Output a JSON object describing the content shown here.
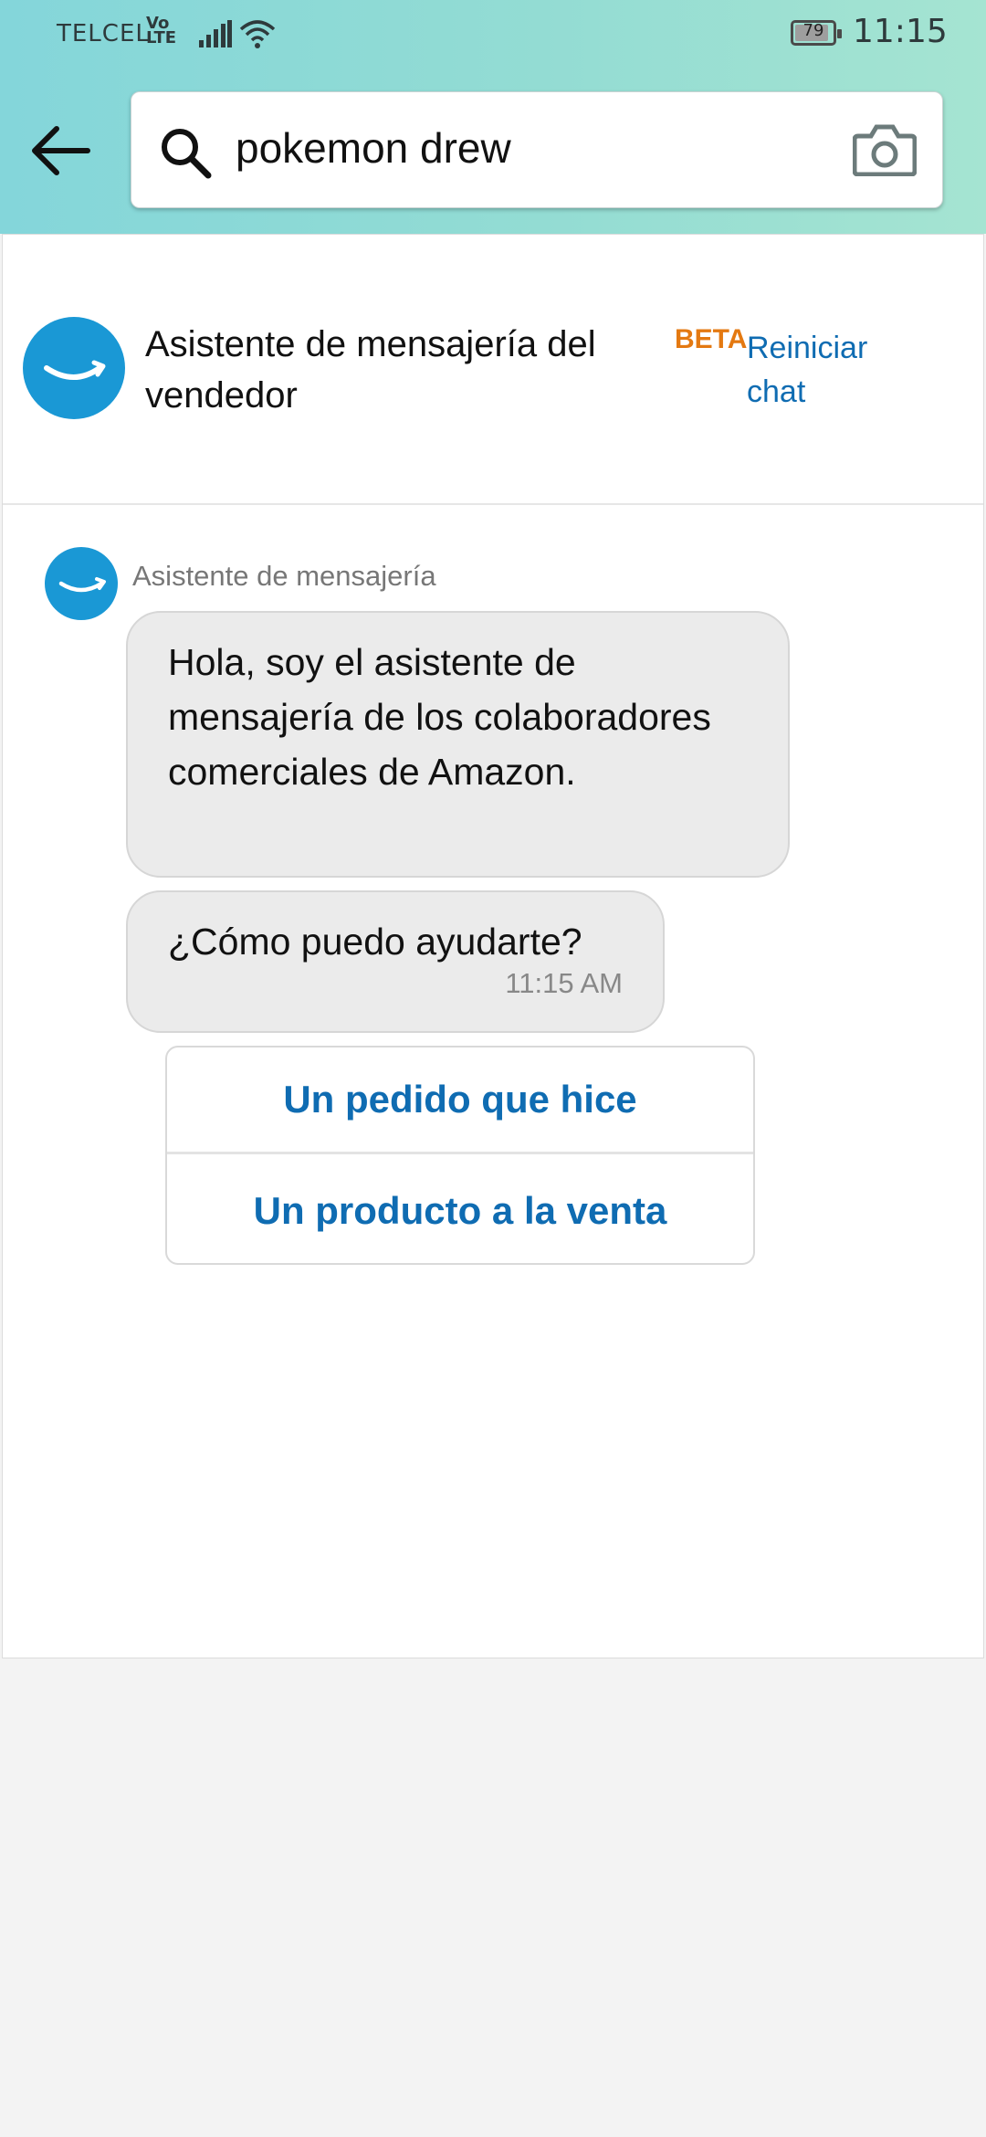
{
  "status_bar": {
    "carrier": "TELCEL",
    "volte": "Vo LTE",
    "battery": "79",
    "time": "11:15"
  },
  "search": {
    "query": "pokemon drew"
  },
  "chat_header": {
    "title": "Asistente de mensajería del vendedor",
    "badge": "BETA",
    "restart_label": "Reiniciar chat"
  },
  "conversation": {
    "sender": "Asistente de mensajería",
    "messages": [
      {
        "text": "Hola, soy el asistente de mensajería de los colaboradores comerciales de Amazon."
      },
      {
        "text": "¿Cómo puedo ayudarte?",
        "time": "11:15 AM"
      }
    ],
    "options": [
      {
        "label": "Un pedido que hice"
      },
      {
        "label": "Un producto a la venta"
      }
    ]
  },
  "colors": {
    "accent_link": "#0f6cb2",
    "beta": "#e47911",
    "avatar": "#1a98d5"
  }
}
